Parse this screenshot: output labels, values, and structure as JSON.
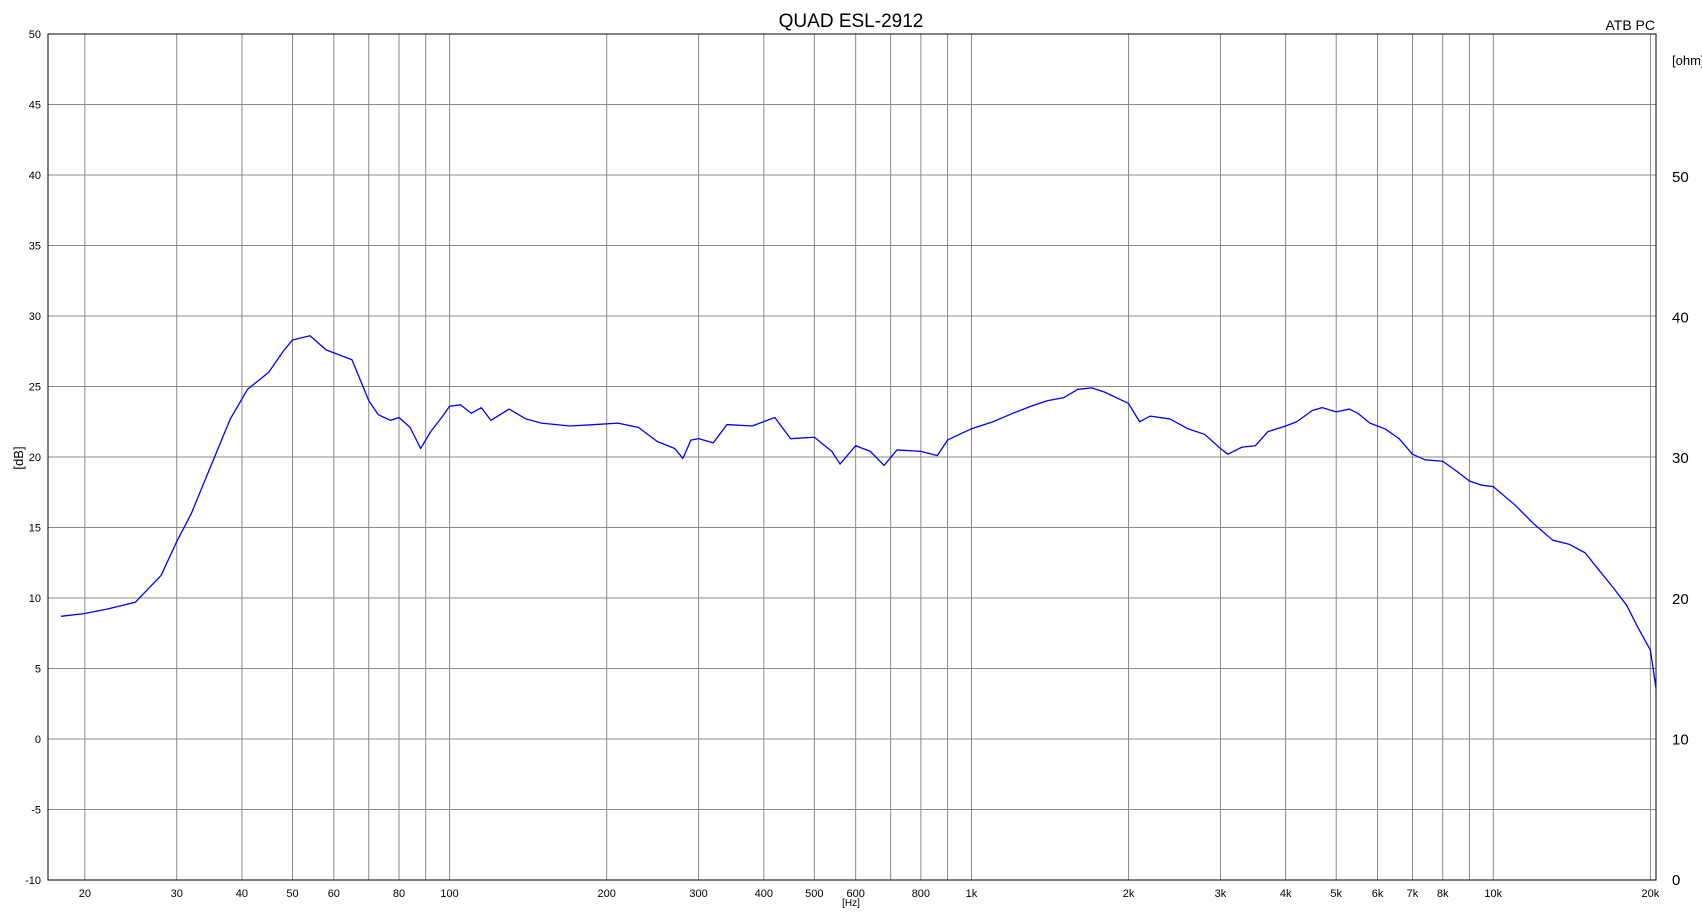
{
  "chart_data": {
    "type": "line",
    "title": "QUAD ESL-2912",
    "corner_label": "ATB PC",
    "xlabel": "[Hz]",
    "ylabel": "[dB]",
    "y2label": "[ohm]",
    "x_scale": "log",
    "xlim": [
      17,
      20500
    ],
    "ylim": [
      -10,
      50
    ],
    "y2lim": [
      0,
      50
    ],
    "grid": true,
    "x_gridlines": [
      20,
      30,
      40,
      50,
      60,
      70,
      80,
      90,
      100,
      200,
      300,
      400,
      500,
      600,
      700,
      800,
      900,
      1000,
      2000,
      3000,
      4000,
      5000,
      6000,
      7000,
      8000,
      9000,
      10000,
      20000
    ],
    "x_ticks": [
      {
        "value": 20,
        "label": "20"
      },
      {
        "value": 30,
        "label": "30"
      },
      {
        "value": 40,
        "label": "40"
      },
      {
        "value": 50,
        "label": "50"
      },
      {
        "value": 60,
        "label": "60"
      },
      {
        "value": 80,
        "label": "80"
      },
      {
        "value": 100,
        "label": "100"
      },
      {
        "value": 200,
        "label": "200"
      },
      {
        "value": 300,
        "label": "300"
      },
      {
        "value": 400,
        "label": "400"
      },
      {
        "value": 500,
        "label": "500"
      },
      {
        "value": 600,
        "label": "600"
      },
      {
        "value": 800,
        "label": "800"
      },
      {
        "value": 1000,
        "label": "1k"
      },
      {
        "value": 2000,
        "label": "2k"
      },
      {
        "value": 3000,
        "label": "3k"
      },
      {
        "value": 4000,
        "label": "4k"
      },
      {
        "value": 5000,
        "label": "5k"
      },
      {
        "value": 6000,
        "label": "6k"
      },
      {
        "value": 7000,
        "label": "7k"
      },
      {
        "value": 8000,
        "label": "8k"
      },
      {
        "value": 10000,
        "label": "10k"
      },
      {
        "value": 20000,
        "label": "20k"
      }
    ],
    "y_ticks": [
      {
        "value": 50,
        "label": "50"
      },
      {
        "value": 45,
        "label": "45"
      },
      {
        "value": 40,
        "label": "40"
      },
      {
        "value": 35,
        "label": "35"
      },
      {
        "value": 30,
        "label": "30"
      },
      {
        "value": 25,
        "label": "25"
      },
      {
        "value": 20,
        "label": "20"
      },
      {
        "value": 15,
        "label": "15"
      },
      {
        "value": 10,
        "label": "10"
      },
      {
        "value": 5,
        "label": "5"
      },
      {
        "value": 0,
        "label": "0"
      },
      {
        "value": -5,
        "label": "-5"
      },
      {
        "value": -10,
        "label": "-10"
      }
    ],
    "y2_ticks": [
      {
        "value": 50,
        "label": "50"
      },
      {
        "value": 40,
        "label": "40"
      },
      {
        "value": 30,
        "label": "30"
      },
      {
        "value": 20,
        "label": "20"
      },
      {
        "value": 10,
        "label": "10"
      },
      {
        "value": 0,
        "label": "0"
      }
    ],
    "series": [
      {
        "color": "#0000ff",
        "x": [
          18,
          20,
          22,
          25,
          28,
          30,
          32,
          35,
          38,
          41,
          45,
          48,
          50,
          54,
          58,
          65,
          70,
          73,
          77,
          80,
          84,
          88,
          92,
          97,
          100,
          105,
          110,
          115,
          120,
          125,
          130,
          140,
          150,
          170,
          190,
          210,
          230,
          250,
          270,
          280,
          290,
          300,
          320,
          340,
          380,
          420,
          450,
          500,
          540,
          560,
          600,
          640,
          680,
          720,
          800,
          860,
          900,
          960,
          1000,
          1100,
          1200,
          1300,
          1400,
          1500,
          1600,
          1700,
          1800,
          2000,
          2100,
          2200,
          2400,
          2600,
          2800,
          3000,
          3100,
          3300,
          3500,
          3700,
          4000,
          4200,
          4500,
          4700,
          5000,
          5300,
          5500,
          5800,
          6200,
          6600,
          7000,
          7400,
          8000,
          8500,
          9000,
          9500,
          10000,
          11000,
          12000,
          13000,
          14000,
          15000,
          16000,
          17000,
          18000,
          19000,
          20000,
          20500
        ],
        "y": [
          8.7,
          8.9,
          9.2,
          9.7,
          11.6,
          14.0,
          16.0,
          19.5,
          22.7,
          24.8,
          26.0,
          27.5,
          28.3,
          28.6,
          27.6,
          26.9,
          24.0,
          23.0,
          22.6,
          22.8,
          22.1,
          20.6,
          21.8,
          22.9,
          23.6,
          23.7,
          23.1,
          23.5,
          22.6,
          23.0,
          23.4,
          22.7,
          22.4,
          22.2,
          22.3,
          22.4,
          22.1,
          21.1,
          20.6,
          19.9,
          21.2,
          21.3,
          21.0,
          22.3,
          22.2,
          22.8,
          21.3,
          21.4,
          20.4,
          19.5,
          20.8,
          20.4,
          19.4,
          20.5,
          20.4,
          20.1,
          21.2,
          21.7,
          22.0,
          22.5,
          23.1,
          23.6,
          24.0,
          24.2,
          24.8,
          24.9,
          24.6,
          23.8,
          22.5,
          22.9,
          22.7,
          22.0,
          21.6,
          20.6,
          20.2,
          20.7,
          20.8,
          21.8,
          22.2,
          22.5,
          23.3,
          23.5,
          23.2,
          23.4,
          23.1,
          22.4,
          22.0,
          21.3,
          20.2,
          19.8,
          19.7,
          19.0,
          18.3,
          18.0,
          17.9,
          16.6,
          15.2,
          14.1,
          13.8,
          13.2,
          11.9,
          10.7,
          9.5,
          7.8,
          6.3,
          3.6
        ]
      }
    ]
  }
}
